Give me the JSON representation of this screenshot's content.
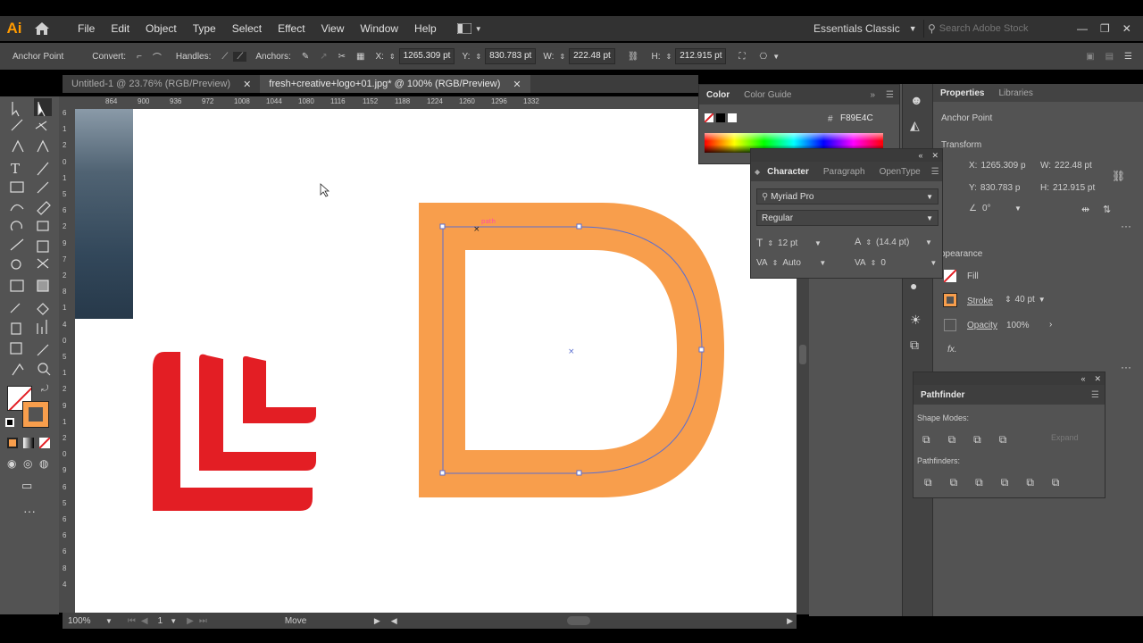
{
  "menubar": {
    "logo": "Ai",
    "items": [
      "File",
      "Edit",
      "Object",
      "Type",
      "Select",
      "Effect",
      "View",
      "Window",
      "Help"
    ],
    "workspace": "Essentials Classic",
    "search_placeholder": "Search Adobe Stock"
  },
  "controlbar": {
    "anchor_point": "Anchor Point",
    "convert": "Convert:",
    "handles": "Handles:",
    "anchors": "Anchors:",
    "x_label": "X:",
    "x_value": "1265.309 pt",
    "y_label": "Y:",
    "y_value": "830.783 pt",
    "w_label": "W:",
    "w_value": "222.48 pt",
    "h_label": "H:",
    "h_value": "212.915 pt"
  },
  "tabs": [
    {
      "label": "Untitled-1 @ 23.76% (RGB/Preview)",
      "active": false
    },
    {
      "label": "fresh+creative+logo+01.jpg* @ 100% (RGB/Preview)",
      "active": true
    }
  ],
  "ruler_top": [
    "864",
    "900",
    "936",
    "972",
    "1008",
    "1044",
    "1080",
    "1116",
    "1152",
    "1188",
    "1224",
    "1260",
    "1296",
    "1332"
  ],
  "ruler_left": [
    "6",
    "1",
    "2",
    "0",
    "1",
    "5",
    "6",
    "2",
    "9",
    "7",
    "2",
    "8",
    "1",
    "4",
    "0",
    "5",
    "1",
    "2",
    "9",
    "1",
    "2",
    "0",
    "9",
    "6",
    "5",
    "6",
    "6",
    "6",
    "8",
    "4"
  ],
  "statusbar": {
    "zoom": "100%",
    "page": "1",
    "tool": "Move"
  },
  "color_panel": {
    "tabs": [
      "Color",
      "Color Guide"
    ],
    "hex_label": "#",
    "hex_value": "F89E4C"
  },
  "character_panel": {
    "tabs": [
      "Character",
      "Paragraph",
      "OpenType"
    ],
    "font_family": "Myriad Pro",
    "font_style": "Regular",
    "font_size": "12 pt",
    "leading": "(14.4 pt)",
    "kerning": "Auto",
    "tracking": "0"
  },
  "properties": {
    "tabs": [
      "Properties",
      "Libraries"
    ],
    "selection": "Anchor Point",
    "transform_label": "Transform",
    "x_label": "X:",
    "x_value": "1265.309 p",
    "y_label": "Y:",
    "y_value": "830.783 p",
    "w_label": "W:",
    "w_value": "222.48 pt",
    "h_label": "H:",
    "h_value": "212.915 pt",
    "angle": "0°",
    "appearance_label": "ppearance",
    "fill_label": "Fill",
    "stroke_label": "Stroke",
    "stroke_value": "40 pt",
    "opacity_label": "Opacity",
    "opacity_value": "100%",
    "fx_label": "fx."
  },
  "pathfinder": {
    "title": "Pathfinder",
    "shape_modes": "Shape Modes:",
    "expand": "Expand",
    "pathfinders": "Pathfinders:"
  },
  "colors": {
    "orange": "#F89E4C",
    "red": "#E31E24",
    "path": "#5b6fd1"
  }
}
